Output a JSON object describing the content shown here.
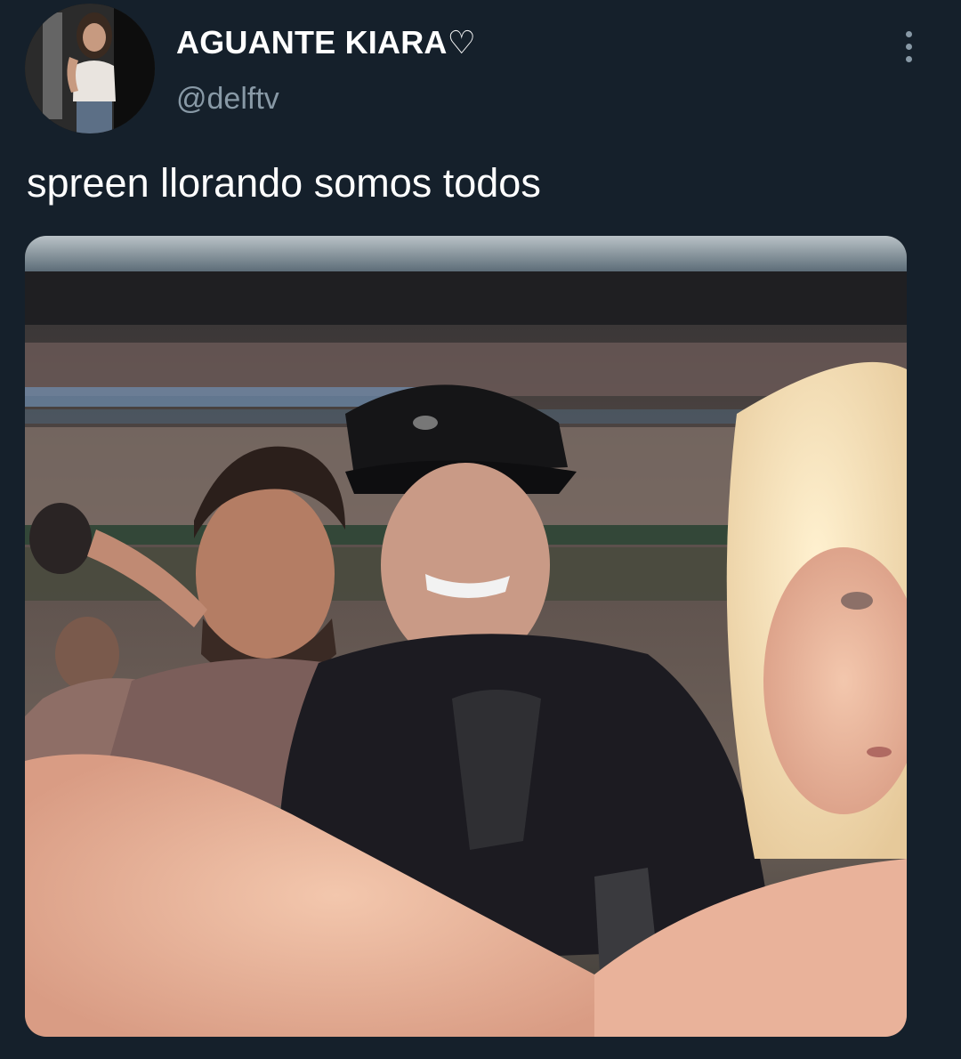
{
  "tweet": {
    "display_name": "AGUANTE KIARA♡",
    "handle": "@delftv",
    "text": "spreen llorando somos todos",
    "more_icon": "more-options-icon"
  },
  "colors": {
    "background": "#15202b",
    "secondary_text": "#8899a6",
    "primary_text": "#ffffff"
  }
}
